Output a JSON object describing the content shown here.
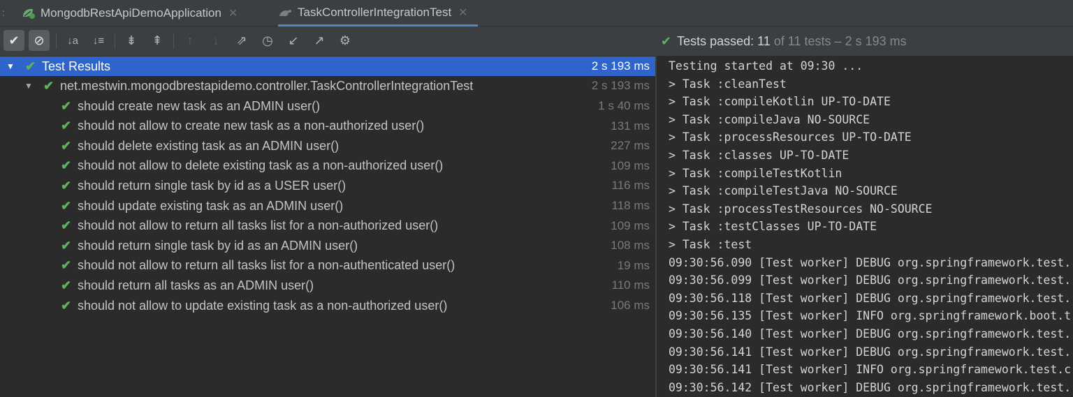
{
  "tabs": [
    {
      "label": "MongodbRestApiDemoApplication",
      "icon": "spring-boot-run-icon",
      "active": false
    },
    {
      "label": "TaskControllerIntegrationTest",
      "icon": "kotlin-test-icon",
      "active": true
    }
  ],
  "toolbar": {
    "show_passed": "✔",
    "show_ignored": "⊘",
    "sort_alpha": "↓a",
    "sort_duration": "↓≡",
    "expand_all": "⇟",
    "collapse_all": "⇞",
    "prev_failed": "↑",
    "next_failed": "↓",
    "import_tests": "⇗",
    "history": "◷",
    "export_in": "↙",
    "export_out": "↗",
    "settings": "⚙"
  },
  "status": {
    "prefix": "Tests passed:",
    "passed_count": "11",
    "suffix": "of 11 tests – 2 s 193 ms"
  },
  "tree": {
    "root": {
      "label": "Test Results",
      "time": "2 s 193 ms"
    },
    "suite": {
      "label": "net.mestwin.mongodbrestapidemo.controller.TaskControllerIntegrationTest",
      "time": "2 s 193 ms"
    },
    "tests": [
      {
        "label": "should create new task as an ADMIN user()",
        "time": "1 s 40 ms"
      },
      {
        "label": "should not allow to create new task as a non-authorized user()",
        "time": "131 ms"
      },
      {
        "label": "should delete existing task as an ADMIN user()",
        "time": "227 ms"
      },
      {
        "label": "should not allow to delete existing task as a non-authorized user()",
        "time": "109 ms"
      },
      {
        "label": "should return single task by id as a USER user()",
        "time": "116 ms"
      },
      {
        "label": "should update existing task as an ADMIN user()",
        "time": "118 ms"
      },
      {
        "label": "should not allow to return all tasks list for a non-authorized user()",
        "time": "109 ms"
      },
      {
        "label": "should return single task by id as an ADMIN user()",
        "time": "108 ms"
      },
      {
        "label": "should not allow to return all tasks list for a non-authenticated user()",
        "time": "19 ms"
      },
      {
        "label": "should return all tasks as an ADMIN user()",
        "time": "110 ms"
      },
      {
        "label": "should not allow to update existing task as a non-authorized user()",
        "time": "106 ms"
      }
    ]
  },
  "console": [
    "Testing started at 09:30 ...",
    "> Task :cleanTest",
    "> Task :compileKotlin UP-TO-DATE",
    "> Task :compileJava NO-SOURCE",
    "> Task :processResources UP-TO-DATE",
    "> Task :classes UP-TO-DATE",
    "> Task :compileTestKotlin",
    "> Task :compileTestJava NO-SOURCE",
    "> Task :processTestResources NO-SOURCE",
    "> Task :testClasses UP-TO-DATE",
    "> Task :test",
    "09:30:56.090 [Test worker] DEBUG org.springframework.test.",
    "09:30:56.099 [Test worker] DEBUG org.springframework.test.",
    "09:30:56.118 [Test worker] DEBUG org.springframework.test.",
    "09:30:56.135 [Test worker] INFO org.springframework.boot.t",
    "09:30:56.140 [Test worker] DEBUG org.springframework.test.",
    "09:30:56.141 [Test worker] DEBUG org.springframework.test.",
    "09:30:56.141 [Test worker] INFO org.springframework.test.c",
    "09:30:56.142 [Test worker] DEBUG org.springframework.test."
  ],
  "colors": {
    "pass": "#5fb15f",
    "selection": "#2f65ca",
    "tab_underline": "#4a88c7"
  }
}
